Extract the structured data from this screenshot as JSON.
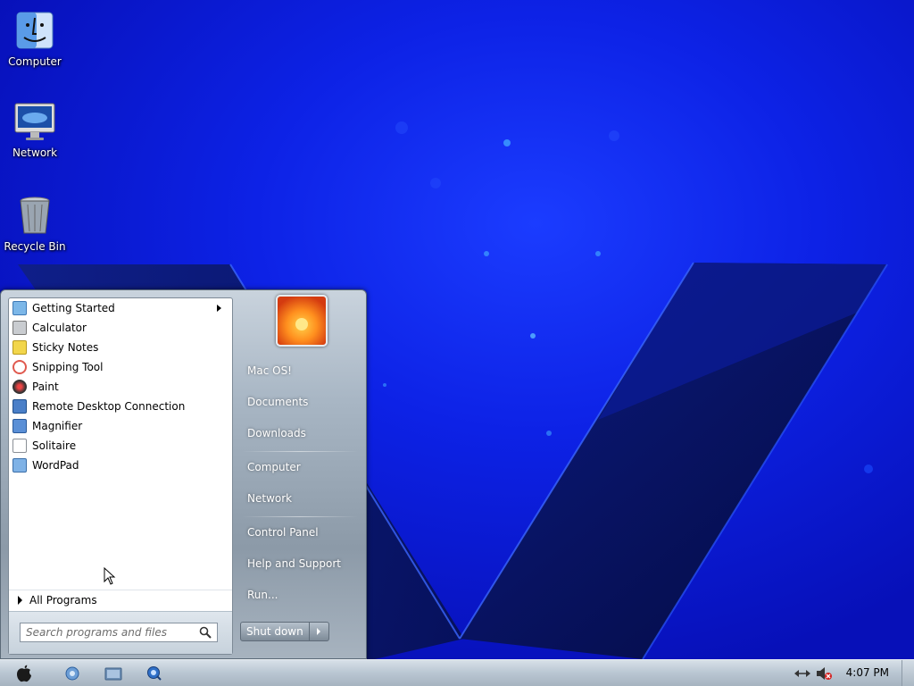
{
  "desktop": {
    "icons": [
      {
        "label": "Computer",
        "icon": "finder-icon"
      },
      {
        "label": "Network",
        "icon": "imac-icon"
      },
      {
        "label": "Recycle Bin",
        "icon": "trash-icon"
      }
    ]
  },
  "start_menu": {
    "programs": [
      {
        "label": "Getting Started",
        "icon": "getting-started-icon",
        "color": "#7cb7e8",
        "submenu": true
      },
      {
        "label": "Calculator",
        "icon": "calculator-icon",
        "color": "#c9ccd0"
      },
      {
        "label": "Sticky Notes",
        "icon": "sticky-notes-icon",
        "color": "#f2d64b"
      },
      {
        "label": "Snipping Tool",
        "icon": "snipping-tool-icon",
        "color": "#e05a4f"
      },
      {
        "label": "Paint",
        "icon": "paint-icon",
        "color": "#3b3b3b"
      },
      {
        "label": "Remote Desktop Connection",
        "icon": "remote-desktop-icon",
        "color": "#4a7fc8"
      },
      {
        "label": "Magnifier",
        "icon": "magnifier-icon",
        "color": "#5a8fd6"
      },
      {
        "label": "Solitaire",
        "icon": "solitaire-icon",
        "color": "#8a8f96"
      },
      {
        "label": "WordPad",
        "icon": "wordpad-icon",
        "color": "#7fb2e6"
      }
    ],
    "all_programs": "All Programs",
    "search_placeholder": "Search programs and files",
    "right_items": [
      {
        "label": "Mac OS!"
      },
      {
        "label": "Documents"
      },
      {
        "label": "Downloads"
      },
      {
        "label": "Computer"
      },
      {
        "label": "Network"
      },
      {
        "label": "Control Panel"
      },
      {
        "label": "Help and Support"
      },
      {
        "label": "Run..."
      }
    ],
    "shutdown_label": "Shut down"
  },
  "taskbar": {
    "start_icon": "apple-icon",
    "pinned": [
      "browser-icon",
      "explorer-folder-icon",
      "media-player-icon"
    ],
    "tray": [
      "network-icon",
      "volume-muted-icon"
    ],
    "clock": "4:07 PM"
  },
  "colors": {
    "desktop_blue": "#0d22e6",
    "taskbar": "#b9c6d2"
  }
}
